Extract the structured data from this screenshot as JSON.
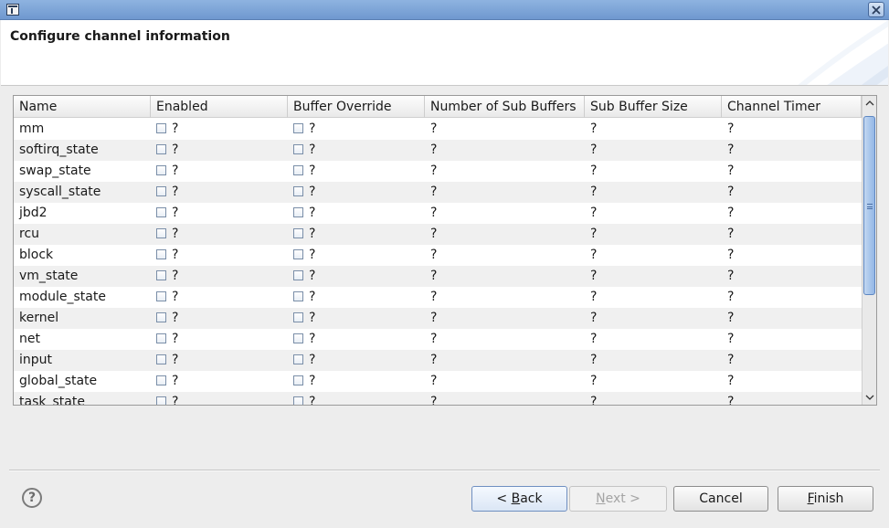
{
  "dialog": {
    "header_title": "Configure channel information"
  },
  "table": {
    "columns": [
      "Name",
      "Enabled",
      "Buffer Override",
      "Number of Sub Buffers",
      "Sub Buffer Size",
      "Channel Timer"
    ],
    "rows": [
      {
        "name": "mm",
        "enabled": "?",
        "buffer_override": "?",
        "num_sub_buffers": "?",
        "sub_buffer_size": "?",
        "channel_timer": "?"
      },
      {
        "name": "softirq_state",
        "enabled": "?",
        "buffer_override": "?",
        "num_sub_buffers": "?",
        "sub_buffer_size": "?",
        "channel_timer": "?"
      },
      {
        "name": "swap_state",
        "enabled": "?",
        "buffer_override": "?",
        "num_sub_buffers": "?",
        "sub_buffer_size": "?",
        "channel_timer": "?"
      },
      {
        "name": "syscall_state",
        "enabled": "?",
        "buffer_override": "?",
        "num_sub_buffers": "?",
        "sub_buffer_size": "?",
        "channel_timer": "?"
      },
      {
        "name": "jbd2",
        "enabled": "?",
        "buffer_override": "?",
        "num_sub_buffers": "?",
        "sub_buffer_size": "?",
        "channel_timer": "?"
      },
      {
        "name": "rcu",
        "enabled": "?",
        "buffer_override": "?",
        "num_sub_buffers": "?",
        "sub_buffer_size": "?",
        "channel_timer": "?"
      },
      {
        "name": "block",
        "enabled": "?",
        "buffer_override": "?",
        "num_sub_buffers": "?",
        "sub_buffer_size": "?",
        "channel_timer": "?"
      },
      {
        "name": "vm_state",
        "enabled": "?",
        "buffer_override": "?",
        "num_sub_buffers": "?",
        "sub_buffer_size": "?",
        "channel_timer": "?"
      },
      {
        "name": "module_state",
        "enabled": "?",
        "buffer_override": "?",
        "num_sub_buffers": "?",
        "sub_buffer_size": "?",
        "channel_timer": "?"
      },
      {
        "name": "kernel",
        "enabled": "?",
        "buffer_override": "?",
        "num_sub_buffers": "?",
        "sub_buffer_size": "?",
        "channel_timer": "?"
      },
      {
        "name": "net",
        "enabled": "?",
        "buffer_override": "?",
        "num_sub_buffers": "?",
        "sub_buffer_size": "?",
        "channel_timer": "?"
      },
      {
        "name": "input",
        "enabled": "?",
        "buffer_override": "?",
        "num_sub_buffers": "?",
        "sub_buffer_size": "?",
        "channel_timer": "?"
      },
      {
        "name": "global_state",
        "enabled": "?",
        "buffer_override": "?",
        "num_sub_buffers": "?",
        "sub_buffer_size": "?",
        "channel_timer": "?"
      },
      {
        "name": "task_state",
        "enabled": "?",
        "buffer_override": "?",
        "num_sub_buffers": "?",
        "sub_buffer_size": "?",
        "channel_timer": "?"
      }
    ]
  },
  "buttons": {
    "help_glyph": "?",
    "back_prefix": "< ",
    "back_mnemonic": "B",
    "back_rest": "ack",
    "next_mnemonic": "N",
    "next_rest": "ext >",
    "cancel": "Cancel",
    "finish_mnemonic": "F",
    "finish_rest": "inish"
  },
  "icons": {
    "window": "window-icon",
    "close": "close-icon",
    "help": "help-icon",
    "checkbox": "checkbox-unchecked"
  },
  "colors": {
    "titlebar": "#7fa6d9",
    "row_alt": "#f0f0f0",
    "scroll_thumb": "#93b7e6"
  }
}
